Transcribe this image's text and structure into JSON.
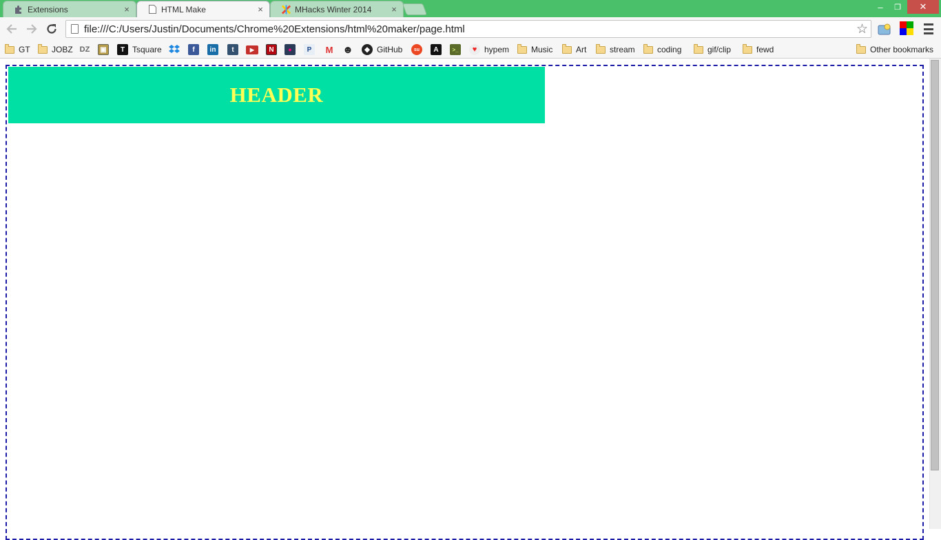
{
  "tabs": [
    {
      "label": "Extensions",
      "icon": "puzzle-icon",
      "active": false
    },
    {
      "label": "HTML Make",
      "icon": "page-icon",
      "active": true
    },
    {
      "label": "MHacks Winter 2014",
      "icon": "mhacks-icon",
      "active": false
    }
  ],
  "window_controls": {
    "minimize": "–",
    "restore": "❐",
    "close": "✕"
  },
  "toolbar": {
    "url": "file:///C:/Users/Justin/Documents/Chrome%20Extensions/html%20maker/page.html"
  },
  "bookmarks": [
    {
      "label": "GT",
      "icon": "folder-icon"
    },
    {
      "label": "JOBZ",
      "icon": "folder-icon"
    },
    {
      "label": "",
      "icon": "dz-icon",
      "glyph": "DZ"
    },
    {
      "label": "",
      "icon": "gt-crest-icon",
      "glyph": "▣"
    },
    {
      "label": "Tsquare",
      "icon": "tsquare-icon"
    },
    {
      "label": "",
      "icon": "dropbox-icon"
    },
    {
      "label": "",
      "icon": "facebook-icon",
      "glyph": "f"
    },
    {
      "label": "",
      "icon": "linkedin-icon",
      "glyph": "in"
    },
    {
      "label": "",
      "icon": "tumblr-icon",
      "glyph": "t"
    },
    {
      "label": "",
      "icon": "youtube-icon",
      "glyph": "▶"
    },
    {
      "label": "",
      "icon": "netflix-icon",
      "glyph": "N"
    },
    {
      "label": "",
      "icon": "flickr-icon",
      "glyph": "●"
    },
    {
      "label": "",
      "icon": "pandora-icon",
      "glyph": "P"
    },
    {
      "label": "",
      "icon": "gmail-icon",
      "glyph": "M"
    },
    {
      "label": "",
      "icon": "reddit-icon",
      "glyph": "☻"
    },
    {
      "label": "GitHub",
      "icon": "github-icon"
    },
    {
      "label": "",
      "icon": "stumbleupon-icon",
      "glyph": "su"
    },
    {
      "label": "",
      "icon": "a-icon",
      "glyph": "A"
    },
    {
      "label": "",
      "icon": "terminal-icon",
      "glyph": ">_"
    },
    {
      "label": "hypem",
      "icon": "hypem-icon"
    },
    {
      "label": "Music",
      "icon": "folder-icon"
    },
    {
      "label": "Art",
      "icon": "folder-icon"
    },
    {
      "label": "stream",
      "icon": "folder-icon"
    },
    {
      "label": "coding",
      "icon": "folder-icon"
    },
    {
      "label": "gif/clip",
      "icon": "folder-icon"
    },
    {
      "label": "fewd",
      "icon": "folder-icon"
    }
  ],
  "other_bookmarks": "Other bookmarks",
  "page": {
    "header_text": "HEADER",
    "header_bg": "#00e0a4",
    "header_color": "#ffff55",
    "border_color": "#1a1aa6"
  },
  "colors": {
    "frame": "#4ac06a",
    "toolbar": "#f6f6f6"
  }
}
